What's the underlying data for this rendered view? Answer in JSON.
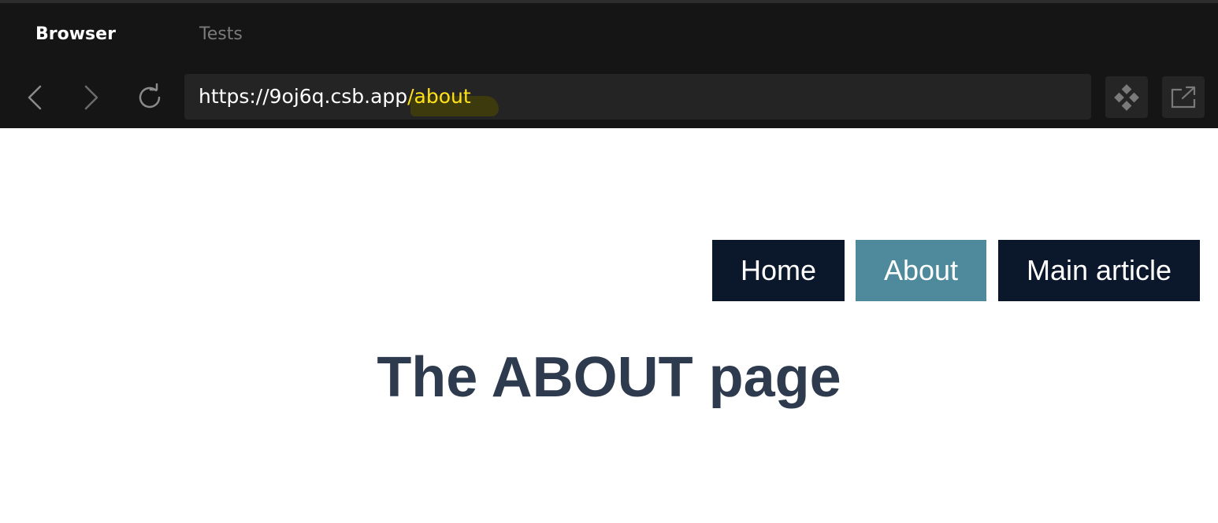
{
  "panel": {
    "tabs": [
      {
        "label": "Browser",
        "active": true
      },
      {
        "label": "Tests",
        "active": false
      }
    ]
  },
  "toolbar": {
    "back_icon": "chevron-left-icon",
    "forward_icon": "chevron-right-icon",
    "refresh_icon": "refresh-icon",
    "devtools_icon": "diamond-cluster-icon",
    "open_external_icon": "open-new-window-icon"
  },
  "address_bar": {
    "base": "https://9oj6q.csb.app",
    "path": "/about",
    "path_color": "#ffe11a"
  },
  "site": {
    "nav": [
      {
        "label": "Home",
        "active": false
      },
      {
        "label": "About",
        "active": true
      },
      {
        "label": "Main article",
        "active": false
      }
    ],
    "heading": "The ABOUT page",
    "colors": {
      "nav_bg": "#0b172a",
      "nav_active_bg": "#4e8a9c",
      "heading": "#2e3a4d"
    }
  }
}
